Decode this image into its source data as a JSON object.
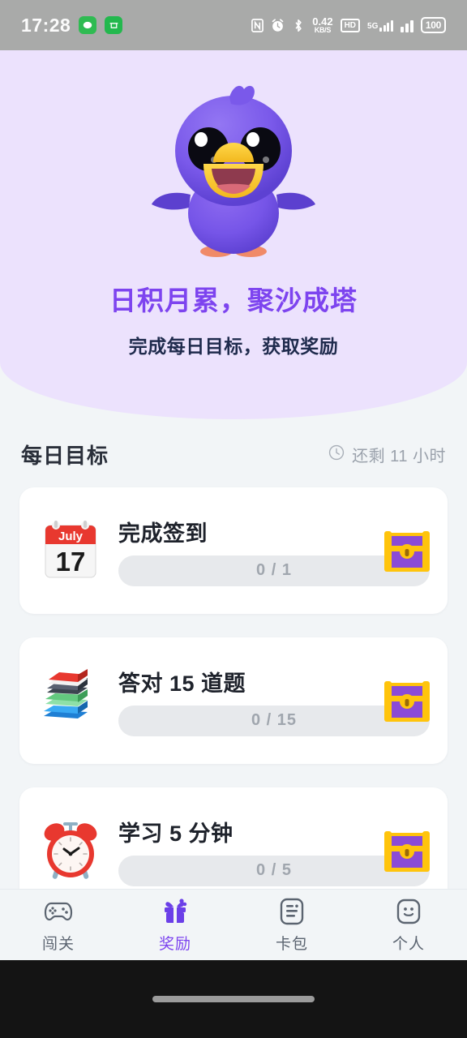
{
  "statusbar": {
    "time": "17:28",
    "network_speed_value": "0.42",
    "network_speed_unit": "KB/S",
    "hd_label": "HD",
    "network_type": "5G",
    "battery": "100",
    "icons": [
      "nfc-icon",
      "alarm-icon",
      "bluetooth-icon",
      "data-speed-icon",
      "hd-call-icon",
      "signal-5g-icon",
      "signal-bars-icon",
      "battery-icon"
    ]
  },
  "hero": {
    "mascot": "purple-bird-mascot",
    "title": "日积月累，聚沙成塔",
    "subtitle": "完成每日目标，获取奖励",
    "background_color": "#ece2fd",
    "title_color": "#7d44ef"
  },
  "section": {
    "title": "每日目标",
    "countdown_icon": "clock-icon",
    "countdown": "还剩 11 小时"
  },
  "tasks": [
    {
      "icon": "calendar-icon",
      "calendar_month": "July",
      "calendar_day": "17",
      "title": "完成签到",
      "progress_label": "0 / 1",
      "current": 0,
      "target": 1,
      "reward_icon": "treasure-chest-icon"
    },
    {
      "icon": "books-icon",
      "title": "答对 15 道题",
      "progress_label": "0 / 15",
      "current": 0,
      "target": 15,
      "reward_icon": "treasure-chest-icon"
    },
    {
      "icon": "alarm-clock-icon",
      "title": "学习 5 分钟",
      "progress_label": "0 / 5",
      "current": 0,
      "target": 5,
      "reward_icon": "treasure-chest-icon"
    }
  ],
  "bottom_nav": {
    "active_color": "#7d44ef",
    "items": [
      {
        "icon": "gamepad-icon",
        "label": "闯关",
        "active": false
      },
      {
        "icon": "gift-icon",
        "label": "奖励",
        "active": true
      },
      {
        "icon": "card-pack-icon",
        "label": "卡包",
        "active": false
      },
      {
        "icon": "person-face-icon",
        "label": "个人",
        "active": false
      }
    ]
  }
}
